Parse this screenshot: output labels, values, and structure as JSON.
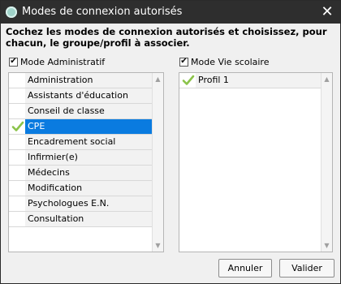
{
  "window": {
    "title": "Modes de connexion autorisés"
  },
  "instruction": "Cochez les modes de connexion autorisés et choisissez, pour chacun, le groupe/profil à associer.",
  "left_panel": {
    "checkbox_label": "Mode Administratif",
    "checked": true,
    "items": [
      {
        "label": "Administration",
        "checked": false,
        "selected": false
      },
      {
        "label": "Assistants d'éducation",
        "checked": false,
        "selected": false
      },
      {
        "label": "Conseil de classe",
        "checked": false,
        "selected": false
      },
      {
        "label": "CPE",
        "checked": true,
        "selected": true
      },
      {
        "label": "Encadrement social",
        "checked": false,
        "selected": false
      },
      {
        "label": "Infirmier(e)",
        "checked": false,
        "selected": false
      },
      {
        "label": "Médecins",
        "checked": false,
        "selected": false
      },
      {
        "label": "Modification",
        "checked": false,
        "selected": false
      },
      {
        "label": "Psychologues E.N.",
        "checked": false,
        "selected": false
      },
      {
        "label": "Consultation",
        "checked": false,
        "selected": false
      }
    ]
  },
  "right_panel": {
    "checkbox_label": "Mode Vie scolaire",
    "checked": true,
    "items": [
      {
        "label": "Profil 1",
        "checked": true,
        "selected": false
      }
    ]
  },
  "buttons": {
    "cancel": "Annuler",
    "ok": "Valider"
  },
  "colors": {
    "selection": "#0a7be0",
    "checkmark": "#8bc34a",
    "titlebar": "#2e2e2e"
  }
}
